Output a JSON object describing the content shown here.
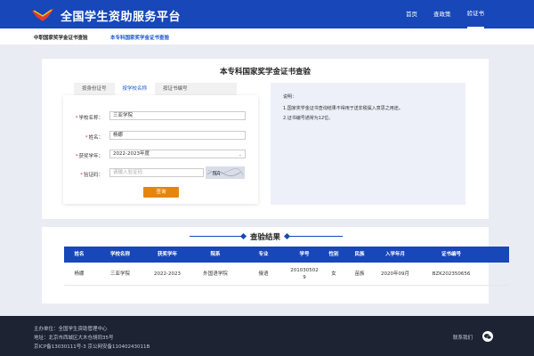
{
  "header": {
    "site_title": "全国学生资助服务平台",
    "nav": [
      "首页",
      "查政策",
      "验证书"
    ]
  },
  "subnav": {
    "items": [
      "中职国家奖学金证书查验",
      "本专科国家奖学金证书查验"
    ]
  },
  "query": {
    "title": "本专科国家奖学金证书查验",
    "tabs": [
      "按身份证号",
      "按学校名称",
      "按证书编号"
    ],
    "form": {
      "school_label": "学校名称：",
      "school_value": "三亚学院",
      "name_label": "姓名：",
      "name_value": "杨娜",
      "year_label": "获奖学年：",
      "year_value": "2022-2023年度",
      "captcha_label": "验证码：",
      "captcha_placeholder": "请输入验证码",
      "captcha_text": "NA",
      "submit_label": "查询"
    },
    "notes": {
      "heading": "说明：",
      "lines": [
        "1.国家奖学金证书查询结果不得用于送非税属入意思之用途。",
        "2.证书编号通常为12位。"
      ]
    }
  },
  "result": {
    "title": "查验结果",
    "columns": [
      "姓名",
      "学校名称",
      "获奖学年",
      "院系",
      "专业",
      "学号",
      "性别",
      "民族",
      "入学年月",
      "证书编号"
    ],
    "rows": [
      [
        "杨娜",
        "三亚学院",
        "2022-2023",
        "外国语学院",
        "俄语",
        "2010305029",
        "女",
        "苗族",
        "2020年09月",
        "BZK202350656"
      ]
    ]
  },
  "footer": {
    "lines": [
      "主办单位：全国学生资助管理中心",
      "地址：北京市西城区大木仓胡同35号",
      "京ICP备13030111号-3 京公网安备11040243011B"
    ],
    "contact_label": "联系我们"
  },
  "colors": {
    "brand_blue": "#1747b8",
    "button_orange": "#e6850e",
    "footer_bg": "#1d2333"
  }
}
